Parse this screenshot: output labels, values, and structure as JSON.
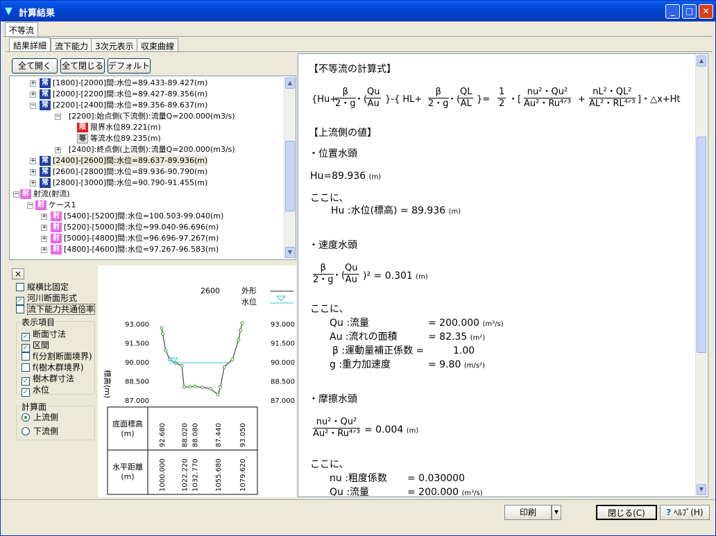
{
  "window": {
    "title": "計算結果"
  },
  "outer_tab": "不等流",
  "tabs": [
    "結果詳細",
    "流下能力",
    "3次元表示",
    "収束曲線"
  ],
  "tree_buttons": {
    "expand": "全て開く",
    "collapse": "全て閉じる",
    "default": "デフォルト"
  },
  "tree": [
    {
      "label": "[1800]-[2000]間:水位=89.433-89.427(m)",
      "icon": "常"
    },
    {
      "label": "[2000]-[2200]間:水位=89.427-89.356(m)",
      "icon": "常"
    },
    {
      "label": "[2200]-[2400]間:水位=89.356-89.637(m)",
      "icon": "常"
    },
    {
      "label": "[2200]:始点側(下流側):流量Q=200.000(m3/s)",
      "icon": ""
    },
    {
      "label": "限界水位89.221(m)",
      "icon": "限"
    },
    {
      "label": "等流水位89.235(m)",
      "icon": "等"
    },
    {
      "label": "[2400]:終点側(上流側):流量Q=200.000(m3/s)",
      "icon": ""
    },
    {
      "label": "[2400]-[2600]間:水位=89.637-89.936(m)",
      "icon": "常"
    },
    {
      "label": "[2600]-[2800]間:水位=89.936-90.790(m)",
      "icon": "常"
    },
    {
      "label": "[2800]-[3000]間:水位=90.790-91.455(m)",
      "icon": "常"
    },
    {
      "label": "射流(射流)",
      "icon": "射"
    },
    {
      "label": "ケース1",
      "icon": "射"
    },
    {
      "label": "[5400]-[5200]間:水位=100.503-99.040(m)",
      "icon": "射"
    },
    {
      "label": "[5200]-[5000]間:水位=99.040-96.696(m)",
      "icon": "射"
    },
    {
      "label": "[5000]-[4800]間:水位=96.696-97.267(m)",
      "icon": "射"
    },
    {
      "label": "[4800]-[4600]間:水位=97.267-96.583(m)",
      "icon": "射"
    }
  ],
  "options": {
    "close": "×",
    "aspect_fixed": "縦横比固定",
    "river_section": "河川断面形式",
    "common_scale": "流下能力共通倍率",
    "display_group": "表示項目",
    "items": [
      "断面寸法",
      "区間",
      "f(分割断面境界)",
      "f(樹木群境界)",
      "樹木群寸法",
      "水位"
    ],
    "items_checked": [
      true,
      true,
      false,
      false,
      true,
      true
    ],
    "calc_group": "計算面",
    "upstream": "上流側",
    "downstream": "下流側"
  },
  "section": {
    "station": "2600",
    "legend_outline": "外形",
    "legend_water": "水位",
    "ylabel": "標高(m)",
    "yticks": [
      "93.000",
      "91.500",
      "90.000",
      "88.500",
      "87.000"
    ],
    "row1_label": "底面標高\n(m)",
    "row2_label": "水平距離\n(m)",
    "elev_labels": [
      "92.680",
      "88.020",
      "88.080",
      "87.440",
      "93.050"
    ],
    "dist_labels": [
      "1000.000",
      "1022.220",
      "1032.770",
      "1055.680",
      "1079.620"
    ],
    "colors": {
      "outline": "#222222",
      "water": "#29C5D6",
      "points": "#3A9A3A"
    }
  },
  "doc": {
    "h1": "【不等流の計算式】",
    "eq_main_left": "{Hu+",
    "eq_main_mid1": "}-{ HL+",
    "eq_main_mid2": "}=",
    "eq_main_tail": "・[",
    "eq_main_end": "]・△x+Ht",
    "h2": "【上流側の値】",
    "s1": "・位置水頭",
    "hu_val": "Hu=89.936",
    "unit_m": "(m)",
    "here": "ここに、",
    "hu_desc": "Hu :水位(標高) = 89.936",
    "s2": "・速度水頭",
    "vel_val": "= 0.301",
    "q_desc": "Qu :流量",
    "q_val": "= 200.000",
    "q_unit": "(m³/s)",
    "a_desc": "Au :流れの面積",
    "a_val": "=     82.35",
    "a_unit": "(m²)",
    "b_desc": "β :運動量補正係数 =",
    "b_val": "1.00",
    "g_desc": "g :重力加速度",
    "g_val": "=      9.80",
    "g_unit": "(m/s²)",
    "s3": "・摩擦水頭",
    "fr_val": "= 0.004",
    "n_desc": "nu :粗度係数",
    "n_val": "= 0.030000",
    "q2_desc": "Qu :流量",
    "q2_val": "=  200.000",
    "q2_unit": "(m³/s)"
  },
  "bottom": {
    "print": "印刷",
    "close": "閉じる(C)",
    "help": "ﾍﾙﾌﾟ(H)"
  }
}
